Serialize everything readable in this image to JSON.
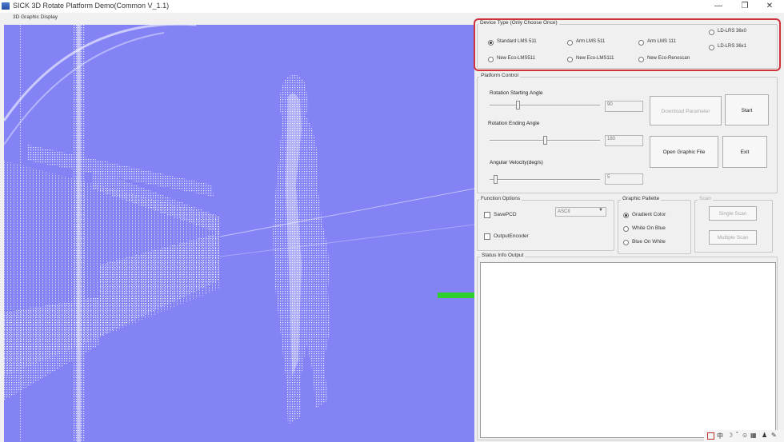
{
  "window": {
    "title": "SICK 3D Rotate Platform Demo(Common V_1.1)",
    "minimize_glyph": "—",
    "restore_glyph": "❐",
    "close_glyph": "✕"
  },
  "display": {
    "label": "3D Graphic Display"
  },
  "device_type": {
    "label": "Device Type (Only Choose Once)",
    "options": [
      {
        "label": "Standard LMS 511",
        "selected": true
      },
      {
        "label": "Arm LMS 511",
        "selected": false
      },
      {
        "label": "Arm LMS 111",
        "selected": false
      },
      {
        "label": "LD-LRS 36x0",
        "selected": false
      },
      {
        "label": "New Eco-LMS511",
        "selected": false
      },
      {
        "label": "New Eco-LMS111",
        "selected": false
      },
      {
        "label": "New Eco-Renoscan",
        "selected": false
      },
      {
        "label": "LD-LRS 36x1",
        "selected": false
      }
    ]
  },
  "platform_control": {
    "label": "Platform Control",
    "rotation_start": {
      "label": "Rotation Starting Angle",
      "value": "90",
      "slider_fraction": 0.25
    },
    "rotation_end": {
      "label": "Rotation Ending Angle",
      "value": "180",
      "slider_fraction": 0.5
    },
    "angular_velocity": {
      "label": "Angular Velocity(deg/s)",
      "value": "5",
      "slider_fraction": 0.05
    },
    "download_button": "Download Parameter",
    "start_button": "Start",
    "open_file_button": "Open Graphic File",
    "exit_button": "Exit"
  },
  "function_options": {
    "label": "Function Options",
    "savepcd_label": "SavePCD",
    "output_encoder_label": "OutputEncoder",
    "format_select": "ASCII"
  },
  "palette": {
    "label": "Graphic Pallette",
    "options": [
      {
        "label": "Gradient Color",
        "selected": true
      },
      {
        "label": "White On Blue",
        "selected": false
      },
      {
        "label": "Blue On White",
        "selected": false
      }
    ]
  },
  "scan": {
    "label": "Scan",
    "single_button": "Single Scan",
    "multiple_button": "Multiple Scan"
  },
  "status": {
    "label": "Status Info Output"
  },
  "tray": {
    "ime": "中"
  },
  "colors": {
    "viewport_bg": "#8383f5",
    "highlight": "#d0313a",
    "axis_green": "#2ccf2c"
  }
}
